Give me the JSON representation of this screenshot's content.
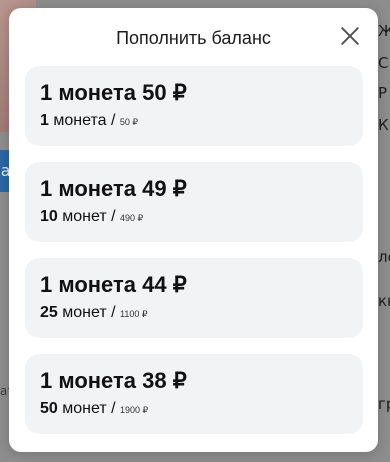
{
  "background": {
    "button_fragment": "са",
    "side_letters": [
      "Ж",
      "С",
      "Р",
      "К",
      "ло",
      "кк",
      "гр"
    ],
    "left_fragment": "ат"
  },
  "modal": {
    "title": "Пополнить баланс",
    "close_icon": "close-icon",
    "options": [
      {
        "price": "1 монета 50 ₽",
        "count": "1",
        "unit": "монета",
        "total": "50 ₽"
      },
      {
        "price": "1 монета 49 ₽",
        "count": "10",
        "unit": "монет",
        "total": "490 ₽"
      },
      {
        "price": "1 монета 44 ₽",
        "count": "25",
        "unit": "монет",
        "total": "1100 ₽"
      },
      {
        "price": "1 монета 38 ₽",
        "count": "50",
        "unit": "монет",
        "total": "1900 ₽"
      }
    ]
  }
}
